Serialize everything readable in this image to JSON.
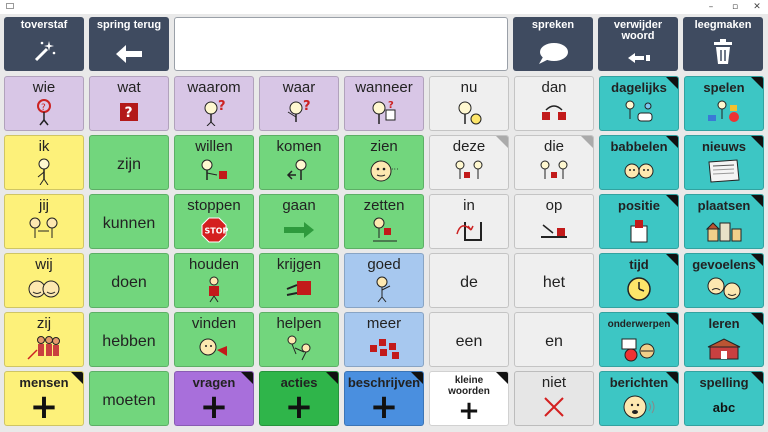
{
  "window": {
    "minimize": "–",
    "maximize": "▫",
    "close": "✕"
  },
  "toolbar": {
    "toverstaf": "toverstaf",
    "spring_terug": "spring terug",
    "spreken": "spreken",
    "verwijder_woord": "verwijder woord",
    "leegmaken": "leegmaken"
  },
  "message_box": {
    "text": ""
  },
  "colors": {
    "toolbar": "#3f4b60",
    "question": "#d8c6e6",
    "pronoun": "#fdf17a",
    "verb": "#72d67d",
    "function_word": "#efefef",
    "topic": "#3dc6c4",
    "adjective": "#a7c8ef"
  },
  "grid": {
    "row1": [
      "wie",
      "wat",
      "waarom",
      "waar",
      "wanneer",
      "nu",
      "dan",
      "dagelijks",
      "spelen"
    ],
    "row2": [
      "ik",
      "zijn",
      "willen",
      "komen",
      "zien",
      "deze",
      "die",
      "babbelen",
      "nieuws"
    ],
    "row3": [
      "jij",
      "kunnen",
      "stoppen",
      "gaan",
      "zetten",
      "in",
      "op",
      "positie",
      "plaatsen"
    ],
    "row4": [
      "wij",
      "doen",
      "houden",
      "krijgen",
      "goed",
      "de",
      "het",
      "tijd",
      "gevoelens"
    ],
    "row5": [
      "zij",
      "hebben",
      "vinden",
      "helpen",
      "meer",
      "een",
      "en",
      "onderwerpen",
      "leren"
    ],
    "row6": [
      "mensen",
      "moeten",
      "vragen",
      "acties",
      "beschrijven",
      "kleine woorden",
      "niet",
      "berichten",
      "spelling"
    ],
    "spelling_icon_text": "abc",
    "stop_sign_text": "STOP"
  }
}
